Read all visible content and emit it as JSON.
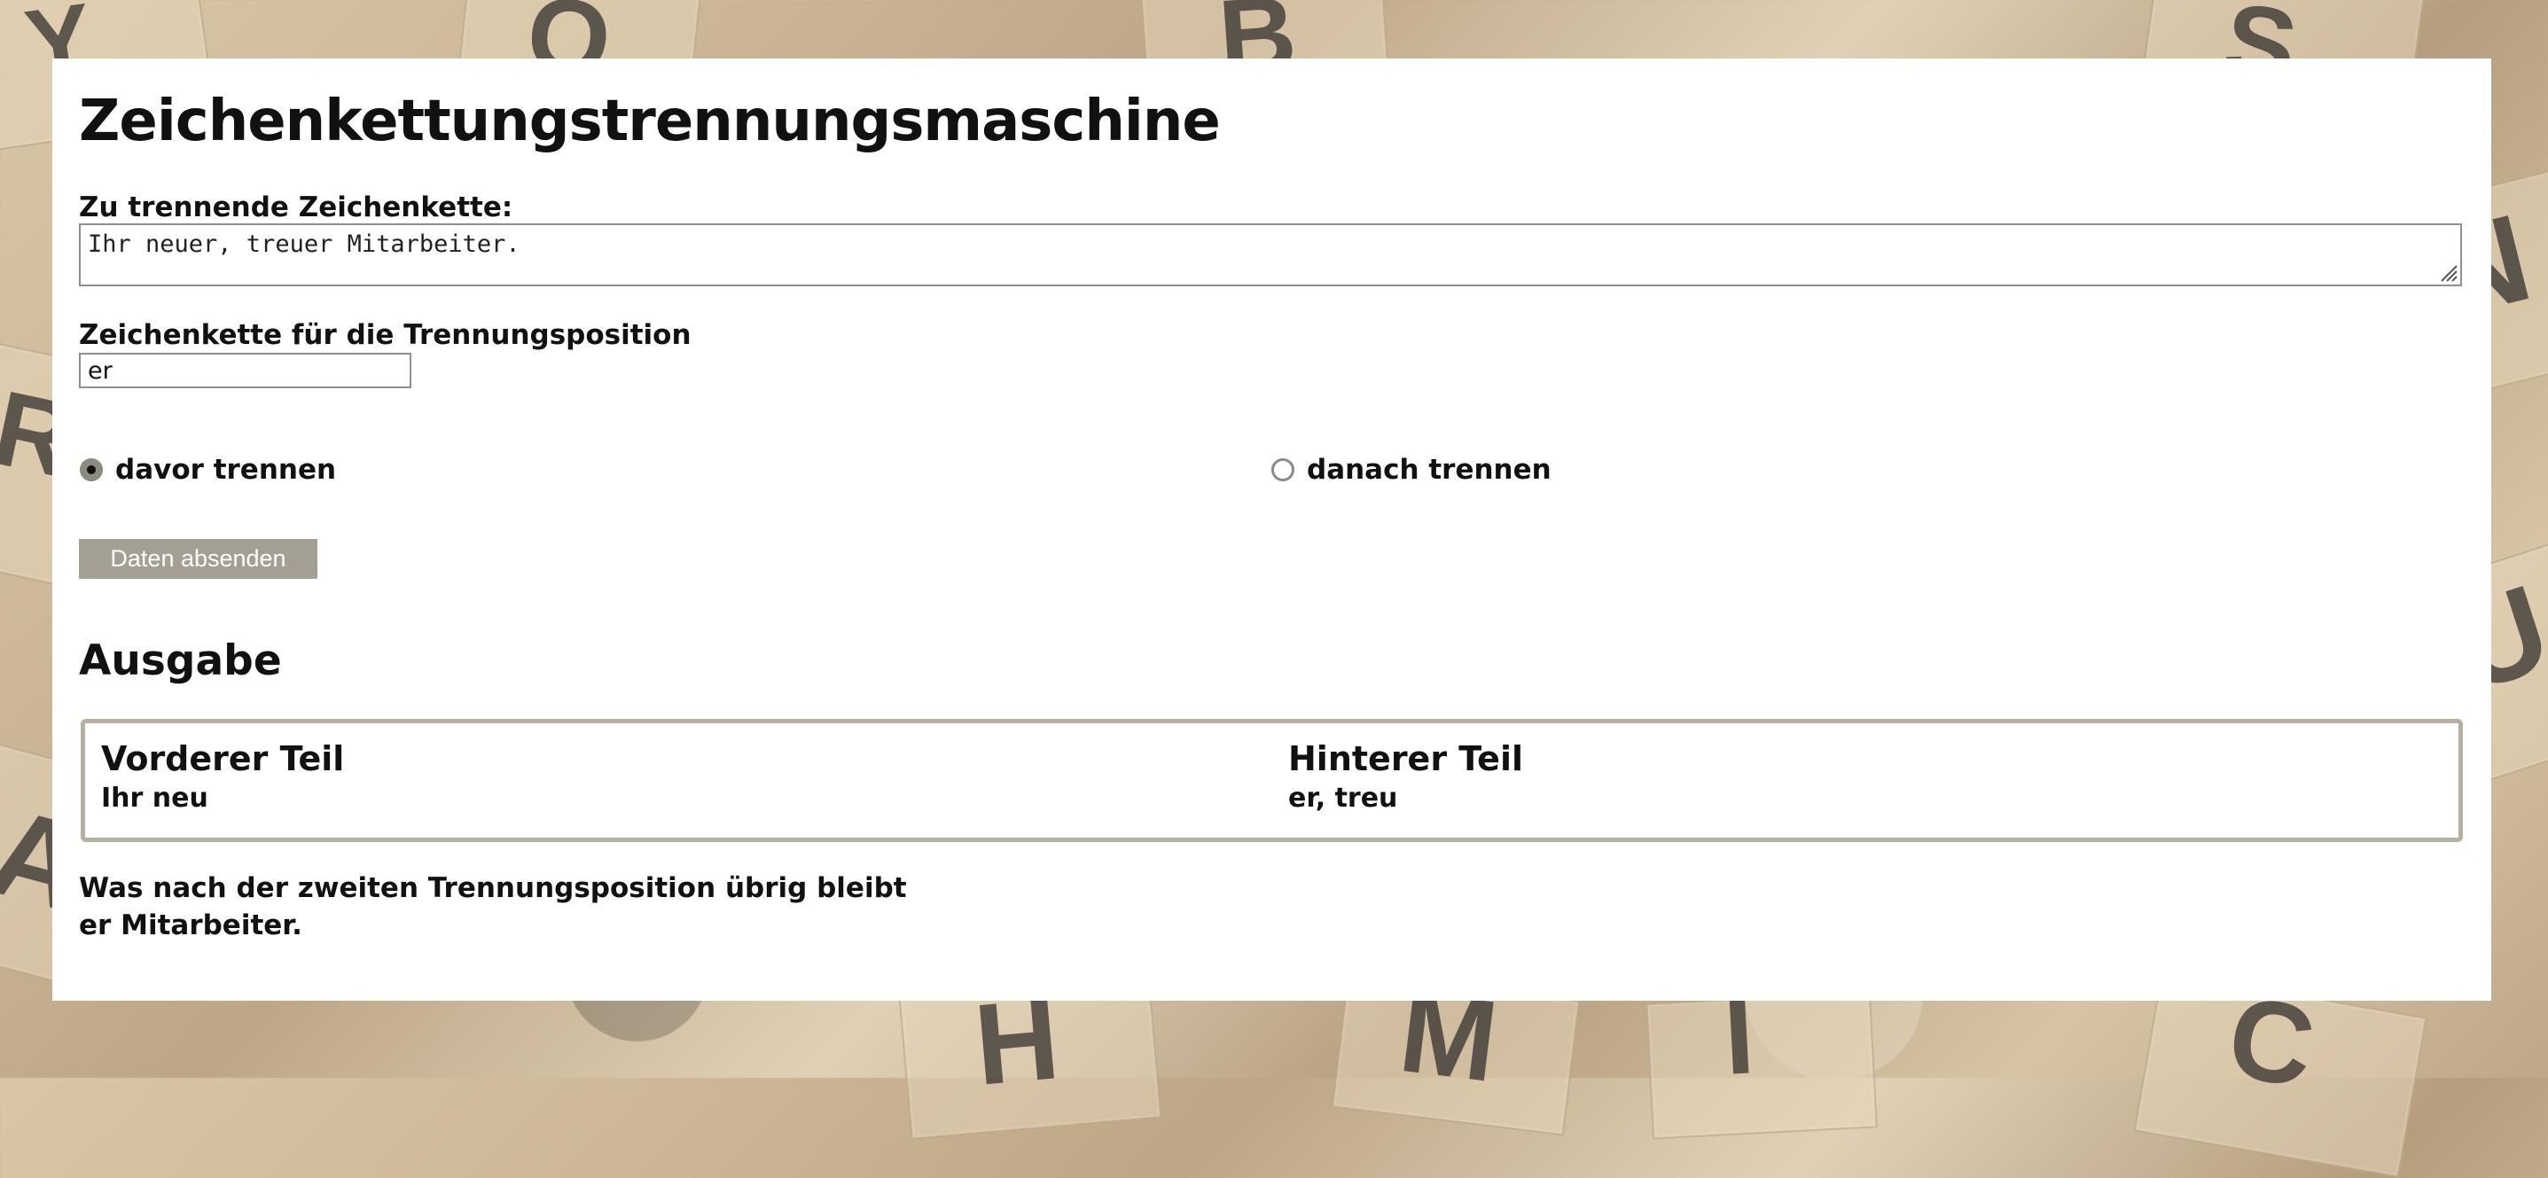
{
  "page": {
    "title": "Zeichenkettungstrennungsmaschine"
  },
  "form": {
    "text_label": "Zu trennende Zeichenkette:",
    "text_value": "Ihr neuer, treuer Mitarbeiter.",
    "split_label": "Zeichenkette für die Trennungsposition",
    "split_value": "er",
    "radio_before_label": "davor trennen",
    "radio_after_label": "danach trennen",
    "submit_label": "Daten absenden"
  },
  "output": {
    "title": "Ausgabe",
    "front_heading": "Vorderer Teil",
    "front_value": "Ihr neu",
    "back_heading": "Hinterer Teil",
    "back_value": "er, treu",
    "remainder_label": "Was nach der zweiten Trennungsposition übrig bleibt",
    "remainder_value": "er Mitarbeiter."
  },
  "background": {
    "tiles": [
      {
        "letter": "Y"
      },
      {
        "letter": "O"
      },
      {
        "letter": "B"
      },
      {
        "letter": "S"
      },
      {
        "letter": "N"
      },
      {
        "letter": "A"
      },
      {
        "letter": "H"
      },
      {
        "letter": "M"
      },
      {
        "letter": "I"
      },
      {
        "letter": "C"
      },
      {
        "letter": "U"
      },
      {
        "letter": "R"
      }
    ]
  },
  "colors": {
    "panel": "#ffffff",
    "accent": "#a39f92",
    "border": "#b5b09f",
    "text": "#111111"
  },
  "icons": {
    "resize": "resize-handle-icon"
  }
}
